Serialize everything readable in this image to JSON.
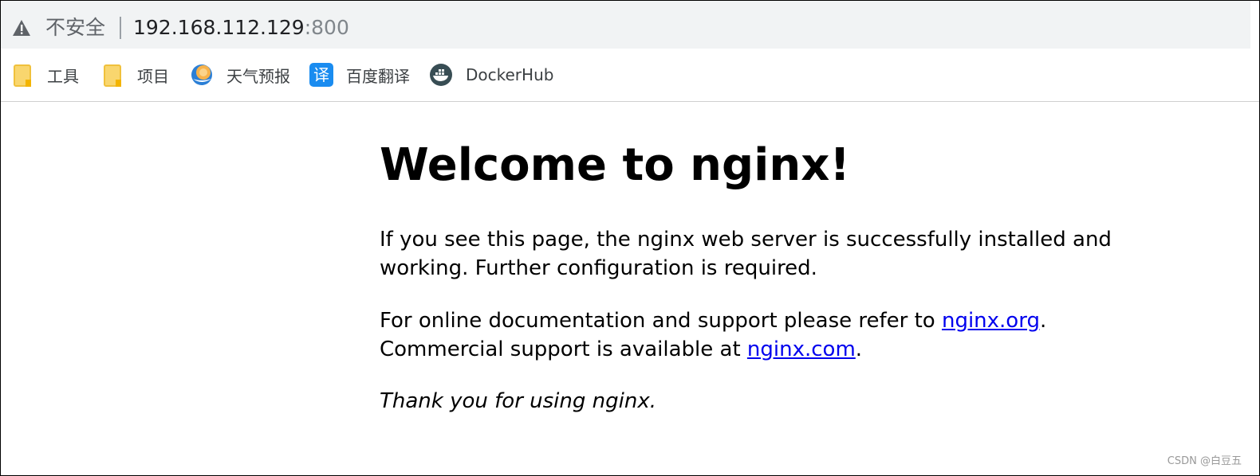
{
  "browser": {
    "security_label": "不安全",
    "url_host": "192.168.112.129",
    "url_port": ":800",
    "warning_icon": "warning-triangle-icon"
  },
  "bookmarks": [
    {
      "label": "工具",
      "icon": "folder-icon"
    },
    {
      "label": "项目",
      "icon": "folder-icon"
    },
    {
      "label": "天气预报",
      "icon": "weather-icon"
    },
    {
      "label": "百度翻译",
      "icon": "translate-icon",
      "icon_glyph": "译"
    },
    {
      "label": "DockerHub",
      "icon": "docker-icon"
    }
  ],
  "page": {
    "title": "Welcome to nginx!",
    "p1": "If you see this page, the nginx web server is successfully installed and working. Further configuration is required.",
    "p2_a": "For online documentation and support please refer to ",
    "p2_link1": "nginx.org",
    "p2_b": ".",
    "p2_c": "Commercial support is available at ",
    "p2_link2": "nginx.com",
    "p2_d": ".",
    "p3": "Thank you for using nginx."
  },
  "watermark": "CSDN @白豆五",
  "colors": {
    "link": "#0000ee",
    "addressbar_bg": "#f1f3f4",
    "folder": "#f9d66e",
    "translate_bg": "#1a8cf0"
  }
}
